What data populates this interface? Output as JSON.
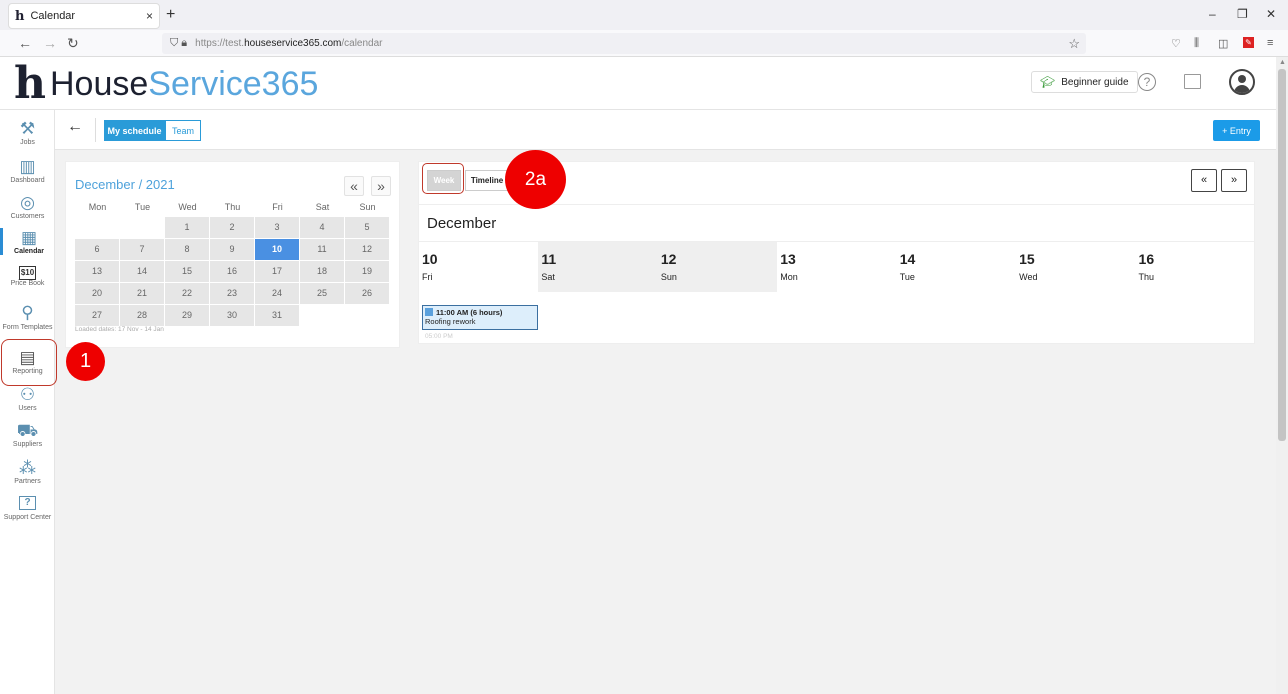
{
  "browser": {
    "tab_title": "Calendar",
    "tab_favicon": "h",
    "tab_close": "×",
    "new_tab": "+",
    "win_min": "–",
    "win_restore": "❐",
    "win_close": "✕",
    "nav_back": "←",
    "nav_forward": "→",
    "nav_reload": "↻",
    "url_prefix": "https://test.",
    "url_domain": "houseservice365.com",
    "url_path": "/calendar"
  },
  "header": {
    "logo_mark": "h",
    "logo_part1": "House",
    "logo_part2": "Service365",
    "beginner_guide": "Beginner guide",
    "help": "?"
  },
  "sidebar": {
    "items": [
      {
        "label": "Jobs",
        "icon": "⚒"
      },
      {
        "label": "Dashboard",
        "icon": "▥"
      },
      {
        "label": "Customers",
        "icon": "◎"
      },
      {
        "label": "Calendar",
        "icon": "▦"
      },
      {
        "label": "Price Book",
        "icon": "$10"
      },
      {
        "label": "Form Templates",
        "icon": "⚲"
      },
      {
        "label": "Reporting",
        "icon": "▤"
      },
      {
        "label": "Users",
        "icon": "⚇"
      },
      {
        "label": "Suppliers",
        "icon": "⛟"
      },
      {
        "label": "Partners",
        "icon": "⁂"
      },
      {
        "label": "Support Center",
        "icon": "?"
      }
    ]
  },
  "toolbar": {
    "back": "←",
    "my_schedule": "My schedule",
    "team": "Team",
    "entry": "+ Entry"
  },
  "mini_calendar": {
    "title": "December / 2021",
    "prev": "«",
    "next": "»",
    "weekdays": [
      "Mon",
      "Tue",
      "Wed",
      "Thu",
      "Fri",
      "Sat",
      "Sun"
    ],
    "weeks": [
      [
        "",
        "",
        "1",
        "2",
        "3",
        "4",
        "5"
      ],
      [
        "6",
        "7",
        "8",
        "9",
        "10",
        "11",
        "12"
      ],
      [
        "13",
        "14",
        "15",
        "16",
        "17",
        "18",
        "19"
      ],
      [
        "20",
        "21",
        "22",
        "23",
        "24",
        "25",
        "26"
      ],
      [
        "27",
        "28",
        "29",
        "30",
        "31",
        "",
        ""
      ]
    ],
    "selected": "10",
    "loaded_dates": "Loaded dates: 17 Nov - 14 Jan"
  },
  "calendar": {
    "view_week": "Week",
    "view_timeline": "Timeline",
    "prev": "«",
    "next": "»",
    "month": "December",
    "days": [
      {
        "num": "10",
        "name": "Fri"
      },
      {
        "num": "11",
        "name": "Sat"
      },
      {
        "num": "12",
        "name": "Sun"
      },
      {
        "num": "13",
        "name": "Mon"
      },
      {
        "num": "14",
        "name": "Tue"
      },
      {
        "num": "15",
        "name": "Wed"
      },
      {
        "num": "16",
        "name": "Thu"
      }
    ],
    "event": {
      "time": "11:00 AM (6 hours)",
      "title": "Roofing rework",
      "end": "05:00 PM"
    }
  },
  "annotations": {
    "marker1": "1",
    "marker2": "2a",
    "color": "#ee0000"
  }
}
